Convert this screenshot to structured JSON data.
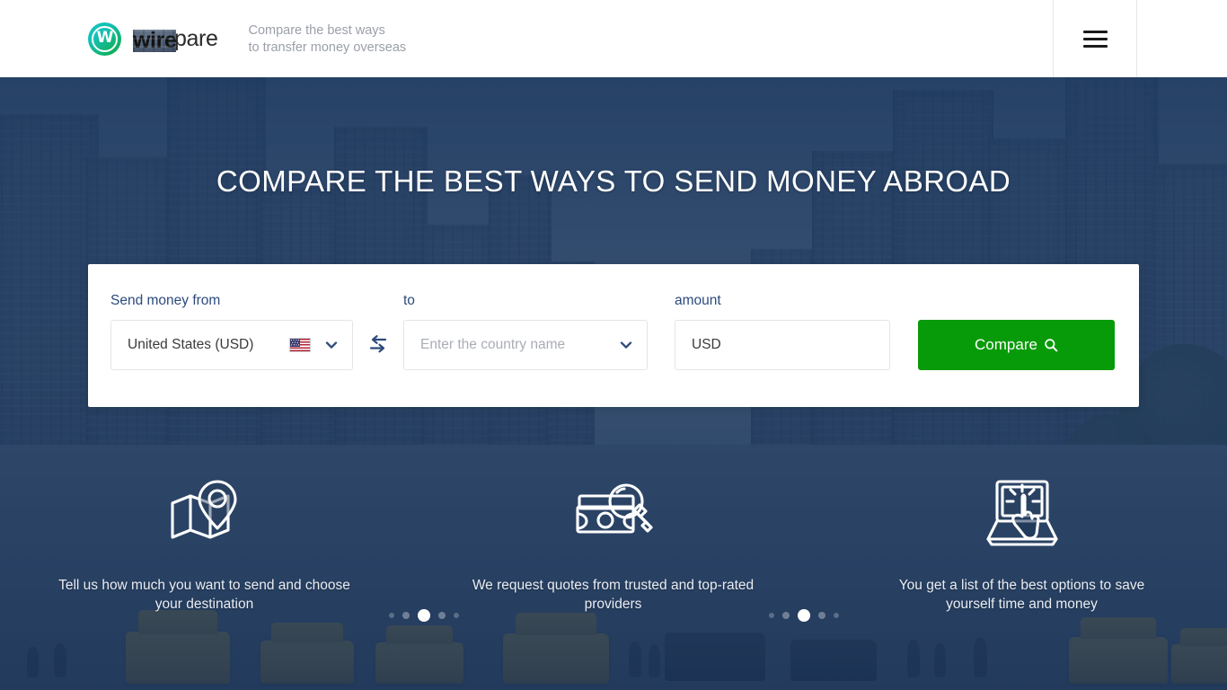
{
  "header": {
    "logo_text_bold": "wire",
    "logo_text_light": "compare",
    "logo_letter": "W",
    "tagline_line1": "Compare the best ways",
    "tagline_line2": "to transfer money overseas",
    "menu_label": "Menu"
  },
  "hero": {
    "title": "COMPARE THE BEST WAYS TO SEND MONEY ABROAD"
  },
  "form": {
    "from": {
      "label": "Send money from",
      "value": "United States (USD)",
      "flag": "us-flag-icon"
    },
    "swap_icon": "swap-arrows-icon",
    "to": {
      "label": "to",
      "value": "",
      "placeholder": "Enter the country name"
    },
    "amount": {
      "label": "amount",
      "value": "USD",
      "placeholder": "USD"
    },
    "compare_button": {
      "label": "Compare",
      "icon": "search-icon",
      "color": "#089b09"
    }
  },
  "features": [
    {
      "icon": "map-location-pin-icon",
      "text": "Tell us how much you want to send and choose your destination"
    },
    {
      "icon": "money-magnifier-icon",
      "text": "We request quotes from trusted and top-rated providers"
    },
    {
      "icon": "laptop-click-hand-icon",
      "text": "You get a list of the best options to save yourself time and money"
    }
  ],
  "carousel": {
    "dot_count": 5,
    "active_index": 2
  },
  "colors": {
    "accent_green": "#089b09",
    "label_navy": "#2c4a7c",
    "logo_teal": "#14c7c0",
    "logo_green": "#0faa4e"
  }
}
